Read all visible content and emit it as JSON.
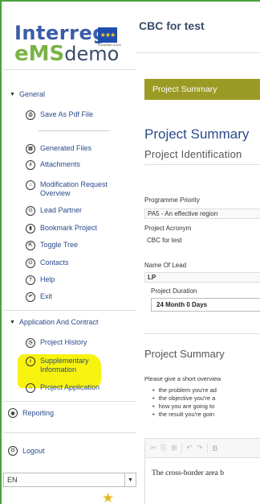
{
  "colors": {
    "frame": "#4aa33c",
    "accent_blue": "#2b4a8a",
    "button_olive": "#9b9a24",
    "highlight": "#f7f20e"
  },
  "logo": {
    "interreg": "Interreg",
    "ems_a": "eMS",
    "ems_b": "demo",
    "flag_sub": "European Union"
  },
  "sidebar": {
    "general": {
      "label": "General",
      "icon": "triangle-down-icon"
    },
    "general_items": [
      {
        "label": "Save As Pdf File",
        "icon": "printer-icon"
      },
      {
        "label": "Generated Files",
        "icon": "folder-icon"
      },
      {
        "label": "Attachments",
        "icon": "paperclip-icon"
      },
      {
        "label": "Modification Request Overview",
        "icon": "lock-icon"
      },
      {
        "label": "Lead Partner",
        "icon": "person-icon"
      },
      {
        "label": "Bookmark Project",
        "icon": "bookmark-icon"
      },
      {
        "label": "Toggle Tree",
        "icon": "share-icon"
      },
      {
        "label": "Contacts",
        "icon": "person-icon"
      },
      {
        "label": "Help",
        "icon": "question-icon"
      },
      {
        "label": "Exit",
        "icon": "exit-icon"
      }
    ],
    "app_contract": {
      "label": "Application And Contract",
      "icon": "triangle-down-icon"
    },
    "app_items": [
      {
        "label": "Project History",
        "icon": "history-icon"
      },
      {
        "label": "Supplementary Information",
        "icon": "info-icon"
      },
      {
        "label": "Project Application",
        "icon": "lock-icon"
      }
    ],
    "reporting": {
      "label": "Reporting",
      "icon": "reporting-icon"
    },
    "logout": {
      "label": "Logout",
      "icon": "power-icon"
    },
    "language": {
      "value": "EN"
    }
  },
  "main": {
    "title": "CBC for test",
    "summary_button": "Project Summary",
    "heading": "Project Summary",
    "subheading": "Project Identification",
    "fields": {
      "programme_priority_label": "Programme Priority",
      "programme_priority_value": "PA5 - An effective region",
      "acronym_label": "Project Acronym",
      "acronym_value": "CBC for test",
      "lead_label": "Name Of Lead",
      "lead_value": "LP",
      "duration_label": "Project Duration",
      "duration_value": "24 Month 0 Days"
    },
    "project_summary_heading": "Project Summary",
    "overview_text": "Please give a short overview",
    "bullets": [
      "the problem you're ad",
      "the objective you're a",
      "how you are going to",
      "the result you're goin"
    ],
    "editor_toolbar": [
      "✂",
      "⎘",
      "⊞",
      "↶",
      "↷",
      "B"
    ],
    "editor_text": "The cross-border area b"
  }
}
